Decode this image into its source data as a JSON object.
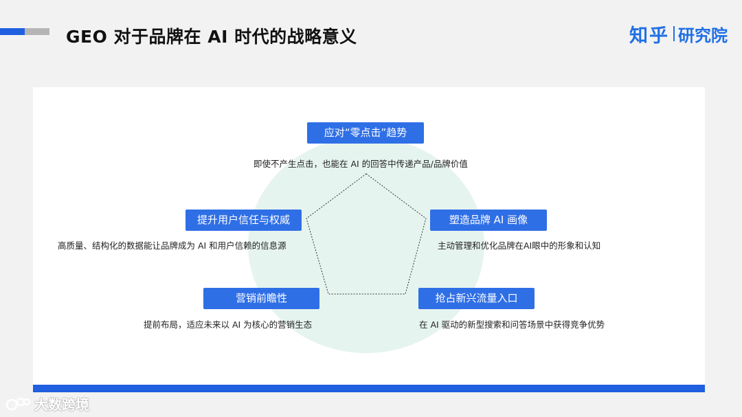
{
  "header": {
    "title": "GEO 对于品牌在 AI 时代的战略意义",
    "logo_brand": "知乎",
    "logo_sub": "研究院"
  },
  "colors": {
    "accent": "#1f5fe0",
    "label_bg": "#2f6fe6",
    "circle_bg": "#e6f4ef",
    "logo": "#1f6fe5"
  },
  "diagram": {
    "nodes": [
      {
        "label": "应对“零点击”趋势",
        "desc": "即使不产生点击，也能在 AI 的回答中传递产品/品牌价值"
      },
      {
        "label": "塑造品牌 AI 画像",
        "desc": "主动管理和优化品牌在AI眼中的形象和认知"
      },
      {
        "label": "抢占新兴流量入口",
        "desc": "在 AI 驱动的新型搜索和问答场景中获得竞争优势"
      },
      {
        "label": "营销前瞻性",
        "desc": "提前布局，适应未来以 AI 为核心的营销生态"
      },
      {
        "label": "提升用户信任与权威",
        "desc": "高质量、结构化的数据能让品牌成为 AI 和用户信赖的信息源"
      }
    ]
  },
  "watermark": {
    "text": "大数跨境",
    "icon": "dashuju-logo-icon"
  }
}
